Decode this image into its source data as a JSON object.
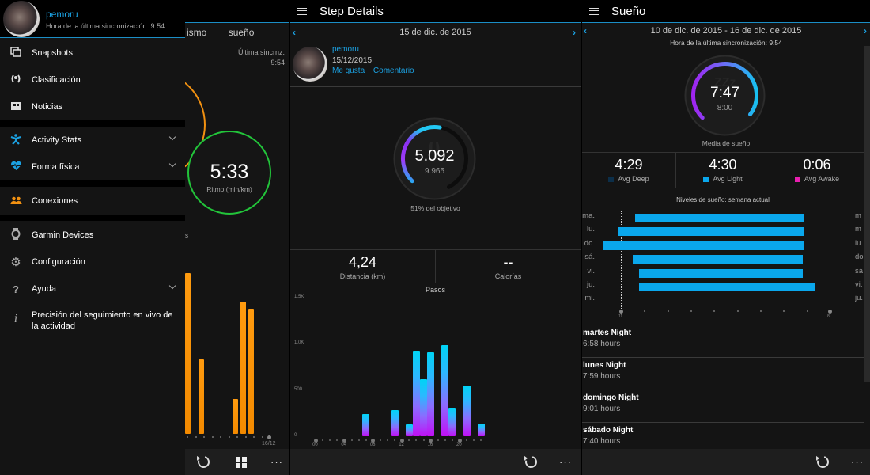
{
  "panel1": {
    "background_app": {
      "tabs": [
        "ismo",
        "sueño"
      ],
      "sync_label": "Última sincrnz.",
      "sync_time": "9:54",
      "pace_value": "5:33",
      "pace_label": "Ritmo (min/km)",
      "chart_end_date": "16/12",
      "axis_fragment": "s"
    },
    "drawer": {
      "user_name": "pemoru",
      "sync_text": "Hora de la última sincronización: 9:54",
      "items": [
        {
          "label": "Snapshots",
          "icon": "snapshots-icon"
        },
        {
          "label": "Clasificación",
          "icon": "laurel-icon"
        },
        {
          "label": "Noticias",
          "icon": "news-icon"
        },
        {
          "label": "Activity Stats",
          "icon": "activity-person-icon",
          "expandable": true
        },
        {
          "label": "Forma física",
          "icon": "heart-icon",
          "expandable": true
        },
        {
          "label": "Conexiones",
          "icon": "connections-icon"
        },
        {
          "label": "Garmin Devices",
          "icon": "watch-icon"
        },
        {
          "label": "Configuración",
          "icon": "gear-icon"
        },
        {
          "label": "Ayuda",
          "icon": "help-icon",
          "expandable": true
        },
        {
          "label": "Precisión del seguimiento en vivo de la actividad",
          "icon": "info-icon"
        }
      ]
    },
    "appbar": {
      "refresh": "refresh-icon",
      "grid": "grid-icon",
      "more": "···"
    }
  },
  "panel2": {
    "title": "Step Details",
    "date": "15 de dic. de 2015",
    "post": {
      "user": "pemoru",
      "date": "15/12/2015",
      "like": "Me gusta",
      "comment": "Comentario"
    },
    "steps": {
      "value": "5.092",
      "goal": "9.965",
      "progress_fraction": 0.51,
      "goal_text": "51% del objetivo"
    },
    "stats": [
      {
        "value": "4,24",
        "label": "Distancia (km)"
      },
      {
        "value": "--",
        "label": "Calorías"
      }
    ],
    "more": "···"
  },
  "panel3": {
    "title": "Sueño",
    "date_range": "10 de dic. de 2015 - 16 de dic. de 2015",
    "sync_text": "Hora de la última sincronización: 9:54",
    "gauge": {
      "value": "7:47",
      "goal": "8:00",
      "label": "Media de sueño",
      "progress_fraction": 0.97
    },
    "stats": [
      {
        "value": "4:29",
        "label": "Avg Deep",
        "color": "#0c2f4a"
      },
      {
        "value": "4:30",
        "label": "Avg Light",
        "color": "#0aa7ec"
      },
      {
        "value": "0:06",
        "label": "Avg Awake",
        "color": "#e91fb0"
      }
    ],
    "nights": [
      {
        "name": "martes Night",
        "hours": "6:58 hours"
      },
      {
        "name": "lunes Night",
        "hours": "7:59 hours"
      },
      {
        "name": "domingo Night",
        "hours": "9:01 hours"
      },
      {
        "name": "sábado Night",
        "hours": "7:40 hours"
      }
    ],
    "more": "···"
  },
  "chart_data": [
    {
      "type": "bar",
      "title": "Pasos",
      "xlabel": "",
      "ylabel": "",
      "ylim": [
        0,
        1500
      ],
      "ytick_labels": [
        "0",
        "500",
        "1,0K",
        "1,5K"
      ],
      "yticks": [
        0,
        500,
        1000,
        1500
      ],
      "xtick_labels": [
        "00",
        "04",
        "08",
        "12",
        "16",
        "20"
      ],
      "x": [
        0,
        1,
        2,
        3,
        4,
        5,
        6,
        7,
        8,
        9,
        10,
        11,
        12,
        13,
        14,
        15,
        16,
        17,
        18,
        19,
        20,
        21,
        22,
        23
      ],
      "values": [
        0,
        0,
        0,
        0,
        0,
        0,
        0,
        240,
        0,
        0,
        0,
        285,
        0,
        130,
        930,
        615,
        910,
        0,
        990,
        305,
        0,
        545,
        0,
        135
      ],
      "colors": {
        "top": "#00d4f5",
        "bottom": "#c010f5"
      }
    },
    {
      "type": "bar",
      "orientation": "horizontal",
      "title": "Niveles de sueño: semana actual",
      "categories": [
        "ma.",
        "lu.",
        "do.",
        "sá.",
        "vi.",
        "ju.",
        "mi."
      ],
      "right_labels": [
        "m",
        "m",
        "lu.",
        "do",
        "sá",
        "vi.",
        "ju."
      ],
      "xtick_labels": [
        "11",
        "8"
      ],
      "xlim_hours": [
        23,
        8
      ],
      "start_hours_after_23": [
        0.6,
        -0.1,
        -0.8,
        0.5,
        0.8,
        0.8,
        null
      ],
      "end_hours_after_23": [
        7.9,
        7.9,
        7.9,
        7.85,
        7.85,
        8.35,
        null
      ],
      "color": "#0aa7ec"
    }
  ]
}
